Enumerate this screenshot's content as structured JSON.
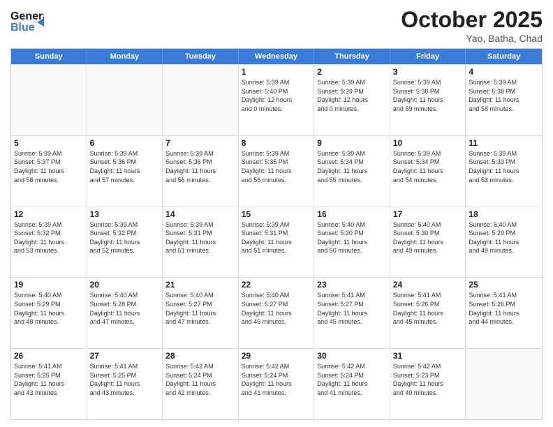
{
  "header": {
    "logo_line1": "General",
    "logo_line2": "Blue",
    "month_title": "October 2025",
    "location": "Yao, Batha, Chad"
  },
  "days_of_week": [
    "Sunday",
    "Monday",
    "Tuesday",
    "Wednesday",
    "Thursday",
    "Friday",
    "Saturday"
  ],
  "weeks": [
    [
      {
        "day": "",
        "lines": []
      },
      {
        "day": "",
        "lines": []
      },
      {
        "day": "",
        "lines": []
      },
      {
        "day": "1",
        "lines": [
          "Sunrise: 5:39 AM",
          "Sunset: 5:40 PM",
          "Daylight: 12 hours",
          "and 0 minutes."
        ]
      },
      {
        "day": "2",
        "lines": [
          "Sunrise: 5:39 AM",
          "Sunset: 5:39 PM",
          "Daylight: 12 hours",
          "and 0 minutes."
        ]
      },
      {
        "day": "3",
        "lines": [
          "Sunrise: 5:39 AM",
          "Sunset: 5:38 PM",
          "Daylight: 11 hours",
          "and 59 minutes."
        ]
      },
      {
        "day": "4",
        "lines": [
          "Sunrise: 5:39 AM",
          "Sunset: 5:38 PM",
          "Daylight: 11 hours",
          "and 58 minutes."
        ]
      }
    ],
    [
      {
        "day": "5",
        "lines": [
          "Sunrise: 5:39 AM",
          "Sunset: 5:37 PM",
          "Daylight: 11 hours",
          "and 58 minutes."
        ]
      },
      {
        "day": "6",
        "lines": [
          "Sunrise: 5:39 AM",
          "Sunset: 5:36 PM",
          "Daylight: 11 hours",
          "and 57 minutes."
        ]
      },
      {
        "day": "7",
        "lines": [
          "Sunrise: 5:39 AM",
          "Sunset: 5:36 PM",
          "Daylight: 11 hours",
          "and 56 minutes."
        ]
      },
      {
        "day": "8",
        "lines": [
          "Sunrise: 5:39 AM",
          "Sunset: 5:35 PM",
          "Daylight: 11 hours",
          "and 56 minutes."
        ]
      },
      {
        "day": "9",
        "lines": [
          "Sunrise: 5:39 AM",
          "Sunset: 5:34 PM",
          "Daylight: 11 hours",
          "and 55 minutes."
        ]
      },
      {
        "day": "10",
        "lines": [
          "Sunrise: 5:39 AM",
          "Sunset: 5:34 PM",
          "Daylight: 11 hours",
          "and 54 minutes."
        ]
      },
      {
        "day": "11",
        "lines": [
          "Sunrise: 5:39 AM",
          "Sunset: 5:33 PM",
          "Daylight: 11 hours",
          "and 53 minutes."
        ]
      }
    ],
    [
      {
        "day": "12",
        "lines": [
          "Sunrise: 5:39 AM",
          "Sunset: 5:32 PM",
          "Daylight: 11 hours",
          "and 53 minutes."
        ]
      },
      {
        "day": "13",
        "lines": [
          "Sunrise: 5:39 AM",
          "Sunset: 5:32 PM",
          "Daylight: 11 hours",
          "and 52 minutes."
        ]
      },
      {
        "day": "14",
        "lines": [
          "Sunrise: 5:39 AM",
          "Sunset: 5:31 PM",
          "Daylight: 11 hours",
          "and 51 minutes."
        ]
      },
      {
        "day": "15",
        "lines": [
          "Sunrise: 5:39 AM",
          "Sunset: 5:31 PM",
          "Daylight: 11 hours",
          "and 51 minutes."
        ]
      },
      {
        "day": "16",
        "lines": [
          "Sunrise: 5:40 AM",
          "Sunset: 5:30 PM",
          "Daylight: 11 hours",
          "and 50 minutes."
        ]
      },
      {
        "day": "17",
        "lines": [
          "Sunrise: 5:40 AM",
          "Sunset: 5:30 PM",
          "Daylight: 11 hours",
          "and 49 minutes."
        ]
      },
      {
        "day": "18",
        "lines": [
          "Sunrise: 5:40 AM",
          "Sunset: 5:29 PM",
          "Daylight: 11 hours",
          "and 49 minutes."
        ]
      }
    ],
    [
      {
        "day": "19",
        "lines": [
          "Sunrise: 5:40 AM",
          "Sunset: 5:29 PM",
          "Daylight: 11 hours",
          "and 48 minutes."
        ]
      },
      {
        "day": "20",
        "lines": [
          "Sunrise: 5:40 AM",
          "Sunset: 5:28 PM",
          "Daylight: 11 hours",
          "and 47 minutes."
        ]
      },
      {
        "day": "21",
        "lines": [
          "Sunrise: 5:40 AM",
          "Sunset: 5:27 PM",
          "Daylight: 11 hours",
          "and 47 minutes."
        ]
      },
      {
        "day": "22",
        "lines": [
          "Sunrise: 5:40 AM",
          "Sunset: 5:27 PM",
          "Daylight: 11 hours",
          "and 46 minutes."
        ]
      },
      {
        "day": "23",
        "lines": [
          "Sunrise: 5:41 AM",
          "Sunset: 5:27 PM",
          "Daylight: 11 hours",
          "and 45 minutes."
        ]
      },
      {
        "day": "24",
        "lines": [
          "Sunrise: 5:41 AM",
          "Sunset: 5:26 PM",
          "Daylight: 11 hours",
          "and 45 minutes."
        ]
      },
      {
        "day": "25",
        "lines": [
          "Sunrise: 5:41 AM",
          "Sunset: 5:26 PM",
          "Daylight: 11 hours",
          "and 44 minutes."
        ]
      }
    ],
    [
      {
        "day": "26",
        "lines": [
          "Sunrise: 5:41 AM",
          "Sunset: 5:25 PM",
          "Daylight: 11 hours",
          "and 43 minutes."
        ]
      },
      {
        "day": "27",
        "lines": [
          "Sunrise: 5:41 AM",
          "Sunset: 5:25 PM",
          "Daylight: 11 hours",
          "and 43 minutes."
        ]
      },
      {
        "day": "28",
        "lines": [
          "Sunrise: 5:42 AM",
          "Sunset: 5:24 PM",
          "Daylight: 11 hours",
          "and 42 minutes."
        ]
      },
      {
        "day": "29",
        "lines": [
          "Sunrise: 5:42 AM",
          "Sunset: 5:24 PM",
          "Daylight: 11 hours",
          "and 41 minutes."
        ]
      },
      {
        "day": "30",
        "lines": [
          "Sunrise: 5:42 AM",
          "Sunset: 5:24 PM",
          "Daylight: 11 hours",
          "and 41 minutes."
        ]
      },
      {
        "day": "31",
        "lines": [
          "Sunrise: 5:42 AM",
          "Sunset: 5:23 PM",
          "Daylight: 11 hours",
          "and 40 minutes."
        ]
      },
      {
        "day": "",
        "lines": []
      }
    ]
  ]
}
